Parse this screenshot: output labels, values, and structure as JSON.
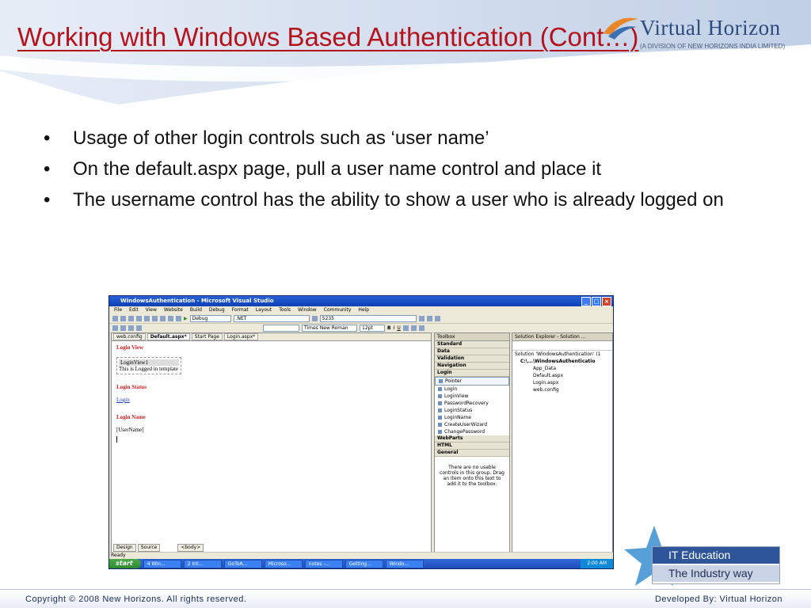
{
  "slide": {
    "title": "Working with Windows Based Authentication (Cont…)",
    "logo": {
      "name": "Virtual Horizon",
      "sub": "(A DIVISION OF NEW HORIZONS INDIA LIMITED)"
    },
    "bullets": [
      "Usage of other login controls such as ‘user name’",
      "On the default.aspx page, pull a user name control and place it",
      "The username control has the ability to show a user who is already logged on"
    ],
    "bullet_char": "•",
    "badge": {
      "line1": "IT Education",
      "line2": "The Industry way"
    },
    "footer": {
      "copyright": "Copyright © 2008 New Horizons. All rights reserved.",
      "developed": "Developed By: Virtual Horizon"
    }
  },
  "vs": {
    "title": "WindowsAuthentication - Microsoft Visual Studio",
    "menu": [
      "File",
      "Edit",
      "View",
      "Website",
      "Build",
      "Debug",
      "Format",
      "Layout",
      "Tools",
      "Window",
      "Community",
      "Help"
    ],
    "toolbar": {
      "config": "Debug",
      "platform": ".NET",
      "search": "5235",
      "font": "Times New Roman",
      "size": "12pt"
    },
    "doc_tabs": [
      "web.config",
      "Default.aspx*",
      "Start Page",
      "Login.aspx*"
    ],
    "design": {
      "login_view_heading": "Login View",
      "loginview_header": "LoginView1",
      "loginview_text": "This is Logged in template",
      "login_status_heading": "Login Status",
      "login_status_link": "Login",
      "login_name_heading": "Login Name",
      "login_name_value": "[UserName]"
    },
    "view_tabs": [
      "Design",
      "Source"
    ],
    "tag": "<body>",
    "toolbox": {
      "header": "Toolbox",
      "categories_top": [
        "Standard",
        "Data",
        "Validation",
        "Navigation",
        "Login"
      ],
      "items": [
        "Pointer",
        "Login",
        "LoginView",
        "PasswordRecovery",
        "LoginStatus",
        "LoginName",
        "CreateUserWizard",
        "ChangePassword"
      ],
      "categories_bottom": [
        "WebParts",
        "HTML",
        "General"
      ],
      "note": "There are no usable controls in this group. Drag an item onto this text to add it to the toolbox."
    },
    "solution": {
      "header": "Solution Explorer - Solution ...",
      "items": [
        "Solution 'WindowsAuthentication' (1",
        "C:\\...\\WindowsAuthenticatio",
        "App_Data",
        "Default.aspx",
        "Login.aspx",
        "web.config"
      ]
    },
    "status": "Ready",
    "taskbar": {
      "start": "start",
      "buttons": [
        "4 Win...",
        "2 Int...",
        "GoToA...",
        "Microso...",
        "notes -...",
        "Getting...",
        "Windo..."
      ],
      "clock": "2:00 AM"
    }
  }
}
